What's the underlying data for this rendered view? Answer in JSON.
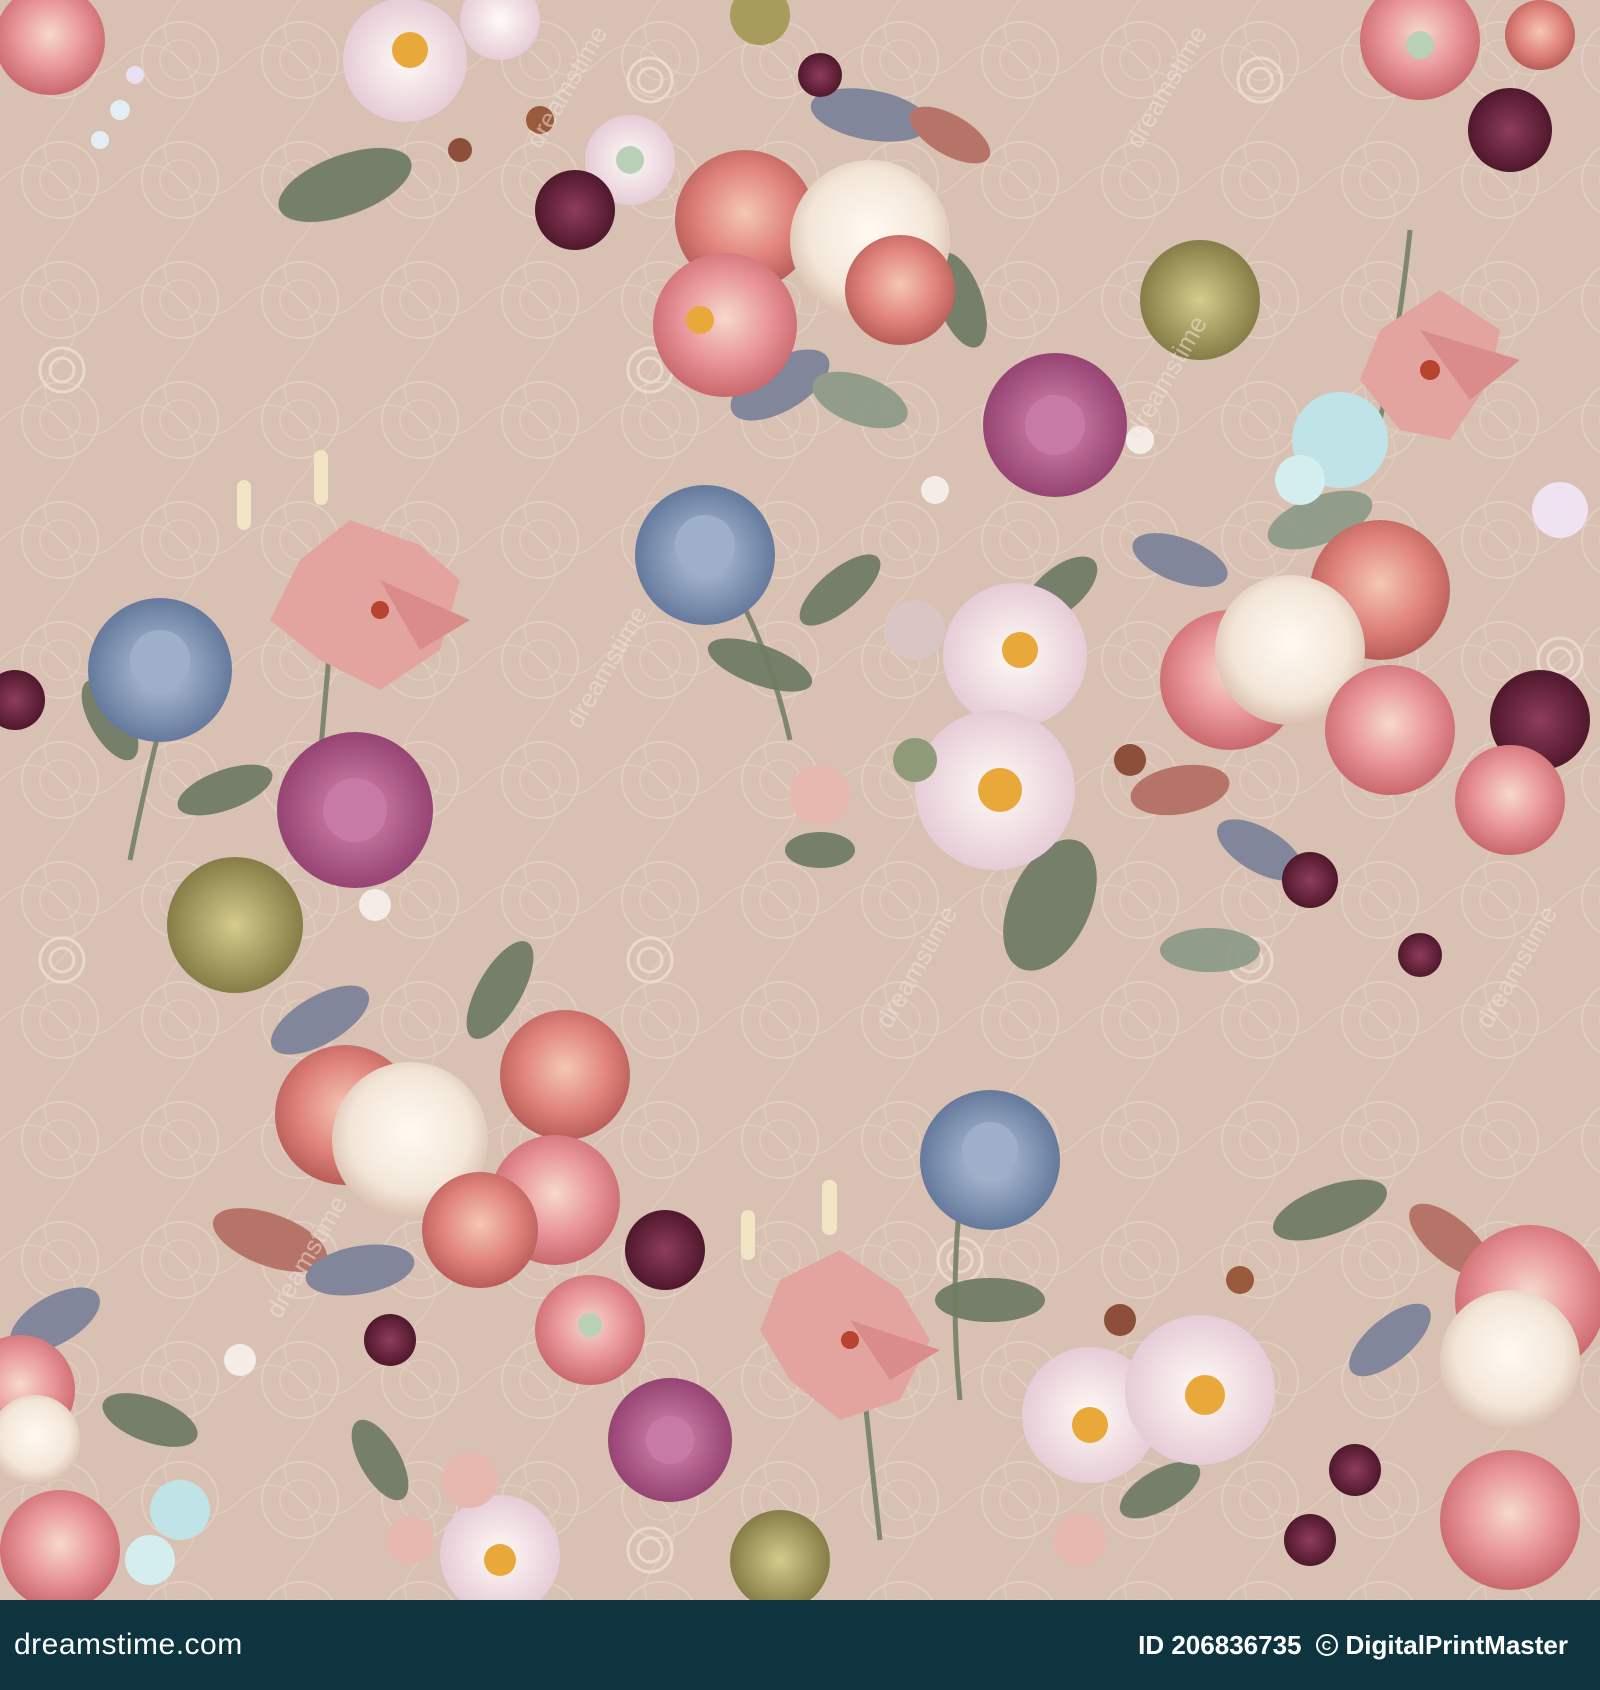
{
  "image": {
    "description_colors": {
      "background": "#d8c1b3",
      "lace": "#ead9cf",
      "peony_pink": "#e9969a",
      "peony_coral": "#e0837c",
      "cream_petal": "#f3e6d8",
      "lily_pink": "#e3a4a0",
      "chrysanthemum_magenta": "#b45a8c",
      "chrysanthemum_blue": "#8097b5",
      "chrysanthemum_olive": "#a79c5c",
      "dark_plum": "#5e1f37",
      "leaf_green": "#6c7a63",
      "leaf_slate": "#7b8199",
      "hydrangea_aqua": "#bfe3e6"
    },
    "watermark_text": "dreamstime"
  },
  "footer": {
    "background": "#0e3440",
    "text_color": "#ffffff",
    "site": "dreamstime.com",
    "image_id": "ID 206836735",
    "author": "DigitalPrintMaster",
    "copyright_icon": "copyright-icon"
  }
}
